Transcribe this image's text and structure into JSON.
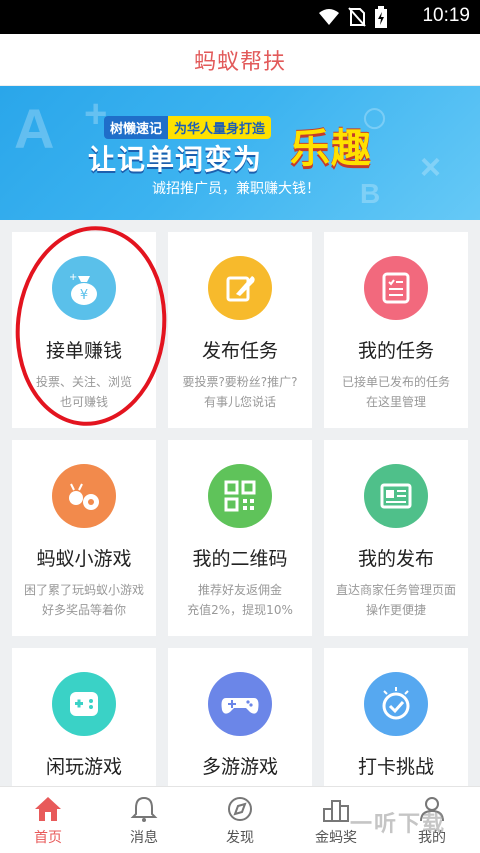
{
  "status_bar": {
    "time": "10:19",
    "icons": [
      "wifi-icon",
      "no-sim-icon",
      "battery-charging-icon"
    ]
  },
  "header": {
    "title": "蚂蚁帮扶"
  },
  "banner": {
    "tag_left": "树懒速记",
    "tag_right": "为华人量身打造",
    "headline": "让记单词变为",
    "headline_highlight": "乐趣",
    "subline": "诚招推广员，兼职赚大钱！",
    "colors": {
      "background": "#2aa6ea",
      "highlight": "#ffe100"
    }
  },
  "cards": [
    {
      "title": "接单赚钱",
      "desc_1": "投票、关注、浏览",
      "desc_2": "也可赚钱",
      "icon": "money-bag-icon",
      "color": "#5ac0ea"
    },
    {
      "title": "发布任务",
      "desc_1": "要投票?要粉丝?推广?",
      "desc_2": "有事儿您说话",
      "icon": "edit-feather-icon",
      "color": "#f7ba2c"
    },
    {
      "title": "我的任务",
      "desc_1": "已接单已发布的任务",
      "desc_2": "在这里管理",
      "icon": "task-list-icon",
      "color": "#f2697d"
    },
    {
      "title": "蚂蚁小游戏",
      "desc_1": "困了累了玩蚂蚁小游戏",
      "desc_2": "好多奖品等着你",
      "icon": "ant-game-icon",
      "color": "#f28a4c"
    },
    {
      "title": "我的二维码",
      "desc_1": "推荐好友返佣金",
      "desc_2": "充值2%，提现10%",
      "icon": "qr-code-icon",
      "color": "#5fc35a"
    },
    {
      "title": "我的发布",
      "desc_1": "直达商家任务管理页面",
      "desc_2": "操作更便捷",
      "icon": "newspaper-icon",
      "color": "#4fc08a"
    },
    {
      "title": "闲玩游戏",
      "desc_1": "",
      "desc_2": "",
      "icon": "gamepad-square-icon",
      "color": "#3ad2c6"
    },
    {
      "title": "多游游戏",
      "desc_1": "",
      "desc_2": "",
      "icon": "controller-icon",
      "color": "#6b86e8"
    },
    {
      "title": "打卡挑战",
      "desc_1": "",
      "desc_2": "",
      "icon": "alarm-check-icon",
      "color": "#56a8f0"
    }
  ],
  "tabbar": [
    {
      "label": "首页",
      "icon": "home-icon",
      "active": true
    },
    {
      "label": "消息",
      "icon": "bell-icon",
      "active": false
    },
    {
      "label": "发现",
      "icon": "compass-icon",
      "active": false
    },
    {
      "label": "金蚂奖",
      "icon": "podium-icon",
      "active": false
    },
    {
      "label": "我的",
      "icon": "user-icon",
      "active": false
    }
  ],
  "watermark": "一听下载",
  "colors": {
    "accent": "#e85a5a",
    "annotation_circle": "#e3141f"
  }
}
